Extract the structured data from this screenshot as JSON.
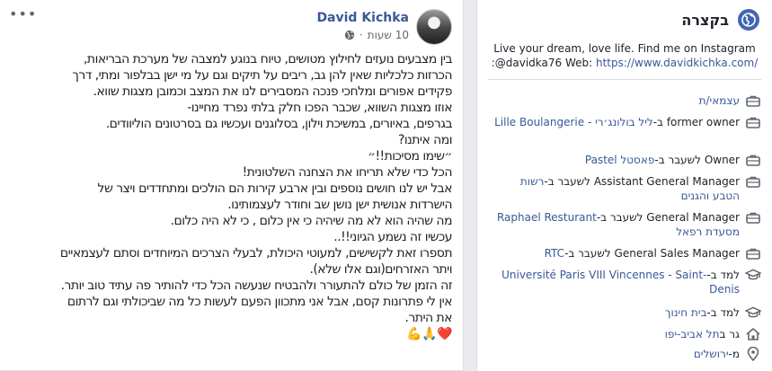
{
  "post": {
    "more_label": "•••",
    "author": "David Kichka",
    "time": "10 שעות",
    "dot": "·",
    "lines": [
      "בין מצבעים נועזים לחילוץ מטושים, טיוח בנוגע למצבה של מערכת הבריאות,",
      "הכרזות כלכליות שאין להן גב, ריבים על תיקים וגם על מי ישן בבלפור ומתי, דרך",
      "פקידים אפורים ומלחכי פנכה המסבירים לנו את המצב וכמובן מצגות שווא.",
      "אוזו מצגות השווא, שכבר הפכו חלק בלתי נפרד מחיינו-",
      "בגרפים, באיורים, במשיכת וילון, בסלוגנים ועכשיו גם בסרטונים הוליוודים.",
      "ומה איתנו?",
      "״שימו מסיכות!!״",
      "הכל כדי שלא תריחו את הצחנה השלטונית!",
      "אבל יש לנו חושים נוספים ובין ארבע קירות הם הולכים ומתחדדים ויצר של",
      "הישרדות אנושית ישן נושן שב וחודר לעצמותינו.",
      "מה שהיה הוא לא מה שיהיה כי אין כלום , כי לא היה כלום.",
      "עכשיו זה נשמע הגיוני!!..",
      "תספרו זאת לקשישים, למעוטי היכולת, לבעלי הצרכים המיוחדים וסתם לעצמאיים",
      "ויתר האזרחים(וגם אלו שלא).",
      "זה הזמן של כולם להתעורר ולהבטיח שנעשה הכל כדי להותיר פה עתיד טוב יותר.",
      "אין לי פתרונות קסם, אבל אני מתכוון הפעם לעשות כל מה שביכולתי וגם לרתום",
      "את היתר.",
      "❤️🙏💪"
    ]
  },
  "intro": {
    "title": "בקצרה",
    "bio_line1": "Live your dream, love life. Find me on Instagram",
    "bio_line2_prefix": "davidka76 Web:",
    "bio_at": ":@",
    "bio_link": "https://www.davidkichka.com/",
    "items": [
      {
        "icon": "briefcase-icon",
        "pre": "",
        "link": "עצמאי/ת",
        "post": ""
      },
      {
        "icon": "briefcase-icon",
        "pre": "former owner ב-",
        "link": "ליל בולונג׳רי - Lille Boulangerie",
        "post": ""
      },
      {
        "icon": "briefcase-icon",
        "pre": "Owner לשעבר ב-",
        "link": "פאסטל Pastel",
        "post": ""
      },
      {
        "icon": "briefcase-icon",
        "pre": "Assistant General Manager לשעבר ב-",
        "link": "רשות הטבע והגנים",
        "post": ""
      },
      {
        "icon": "briefcase-icon",
        "pre": "General Manager לשעבר ב-",
        "link": "Raphael Resturant מסעדת רפאל",
        "post": ""
      },
      {
        "icon": "briefcase-icon",
        "pre": "General Sales Manager לשעבר ב-",
        "link": "RTC",
        "post": ""
      },
      {
        "icon": "graduation-cap-icon",
        "pre": "למד ב-",
        "link": "Université Paris VIII Vincennes - Saint-Denis",
        "post": ""
      },
      {
        "icon": "graduation-cap-icon",
        "pre": "למד ב-",
        "link": "בית חינוך",
        "post": ""
      },
      {
        "icon": "home-icon",
        "pre": "גר ב",
        "link": "תל אביב-יפו",
        "post": ""
      },
      {
        "icon": "location-pin-icon",
        "pre": "מ-",
        "link": "ירושלים",
        "post": ""
      }
    ]
  },
  "colors": {
    "link": "#385898",
    "icon": "#606770",
    "intro_icon": "#4267b2",
    "background": "#e9ebee"
  }
}
